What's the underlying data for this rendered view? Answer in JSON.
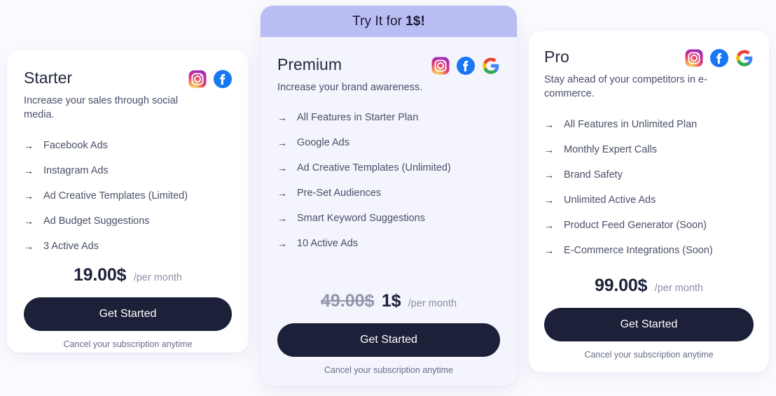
{
  "page": {
    "background_color": "#fbfbff",
    "cta_color": "#1c2038",
    "highlight_banner_color": "#b9bdf4"
  },
  "plans": [
    {
      "id": "starter",
      "name": "Starter",
      "description": "Increase your sales through social media.",
      "socials": [
        "instagram-icon",
        "facebook-icon"
      ],
      "features": [
        "Facebook Ads",
        "Instagram Ads",
        "Ad Creative Templates (Limited)",
        "Ad Budget Suggestions",
        "3 Active Ads"
      ],
      "price": "19.00$",
      "price_old": "",
      "period": "/per month",
      "cta_label": "Get Started",
      "cancel_note": "Cancel your subscription anytime"
    },
    {
      "id": "premium",
      "banner_prefix": "Try It for",
      "banner_highlight": "1$!",
      "name": "Premium",
      "description": "Increase your brand awareness.",
      "socials": [
        "instagram-icon",
        "facebook-icon",
        "google-icon"
      ],
      "features": [
        "All Features in Starter Plan",
        "Google Ads",
        "Ad Creative Templates (Unlimited)",
        "Pre-Set Audiences",
        "Smart Keyword Suggestions",
        "10 Active Ads"
      ],
      "price_old": "49.00$",
      "price": "1$",
      "period": "/per month",
      "cta_label": "Get Started",
      "cancel_note": "Cancel your subscription anytime"
    },
    {
      "id": "pro",
      "name": "Pro",
      "description": "Stay ahead of your competitors in e-commerce.",
      "socials": [
        "instagram-icon",
        "facebook-icon",
        "google-icon"
      ],
      "features": [
        "All Features in Unlimited Plan",
        "Monthly Expert Calls",
        "Brand Safety",
        "Unlimited Active Ads",
        "Product Feed Generator (Soon)",
        "E-Commerce Integrations (Soon)"
      ],
      "price": "99.00$",
      "price_old": "",
      "period": "/per month",
      "cta_label": "Get Started",
      "cancel_note": "Cancel your subscription anytime"
    }
  ],
  "icons": {
    "feature_arrow": "→"
  }
}
